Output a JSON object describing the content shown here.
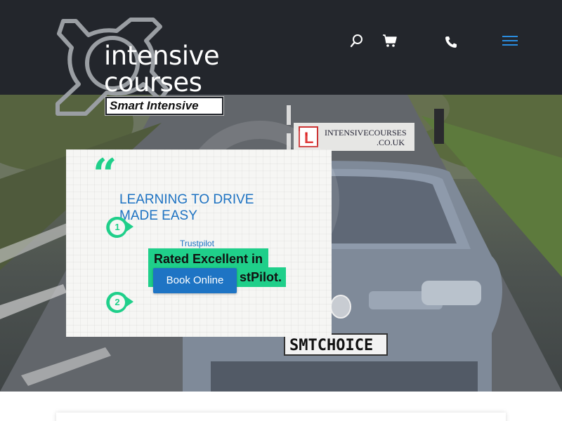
{
  "brand": {
    "logo_line1": "intensive",
    "logo_line2": "courses",
    "logo_badge": "Smart Intensive"
  },
  "header_icons": [
    "search-icon",
    "cart-icon",
    "phone-icon",
    "menu-icon"
  ],
  "hero": {
    "sign_line1": "INTENSIVECOURSES",
    "sign_line2": ".CO.UK",
    "plate": "SMTCHOICE",
    "l_plate": "L"
  },
  "card": {
    "quote": "“",
    "title": "LEARNING TO DRIVE MADE EASY",
    "step1": "1",
    "step2": "2",
    "trustpilot": "Trustpilot",
    "rated_line1": "Rated Excellent in",
    "rated_line2": "stPilot.",
    "book_button": "Book Online"
  },
  "colors": {
    "header_bg": "#23262c",
    "accent_green": "#1fcf8a",
    "accent_blue": "#1d72c2",
    "button_blue": "#1e74c4"
  }
}
